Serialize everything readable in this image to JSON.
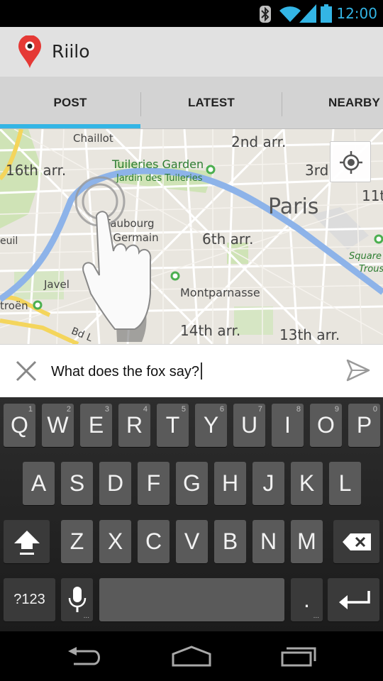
{
  "status_bar": {
    "time": "12:00"
  },
  "app": {
    "title": "Riilo"
  },
  "tabs": [
    {
      "label": "POST"
    },
    {
      "label": "LATEST"
    },
    {
      "label": "NEARBY"
    }
  ],
  "map": {
    "labels": {
      "chaillot": "Chaillot",
      "arr2": "2nd arr.",
      "arr16": "16th arr.",
      "tuileries": "Tuileries Garden",
      "jardin": "Jardin des Tuileries",
      "arr3": "3rd",
      "arr11": "11t",
      "paris": "Paris",
      "faubourg": "Faubourg",
      "stgermain": "St-Germain",
      "arr6": "6th arr.",
      "eui": "euil",
      "square": "Square",
      "trous": "Trous",
      "javel": "Javel",
      "montparnasse": "Montparnasse",
      "roen": "troën",
      "arr14": "14th arr.",
      "arr13": "13th arr.",
      "bdl": "Bd L"
    }
  },
  "compose": {
    "text": "What does the fox say?"
  },
  "keyboard": {
    "row1": [
      {
        "label": "Q",
        "hint": "1"
      },
      {
        "label": "W",
        "hint": "2"
      },
      {
        "label": "E",
        "hint": "3"
      },
      {
        "label": "R",
        "hint": "4"
      },
      {
        "label": "T",
        "hint": "5"
      },
      {
        "label": "Y",
        "hint": "6"
      },
      {
        "label": "U",
        "hint": "7"
      },
      {
        "label": "I",
        "hint": "8"
      },
      {
        "label": "O",
        "hint": "9"
      },
      {
        "label": "P",
        "hint": "0"
      }
    ],
    "row2": [
      "A",
      "S",
      "D",
      "F",
      "G",
      "H",
      "J",
      "K",
      "L"
    ],
    "row3": [
      "Z",
      "X",
      "C",
      "V",
      "B",
      "N",
      "M"
    ],
    "symbols": "?123",
    "period": ".",
    "more": "..."
  }
}
